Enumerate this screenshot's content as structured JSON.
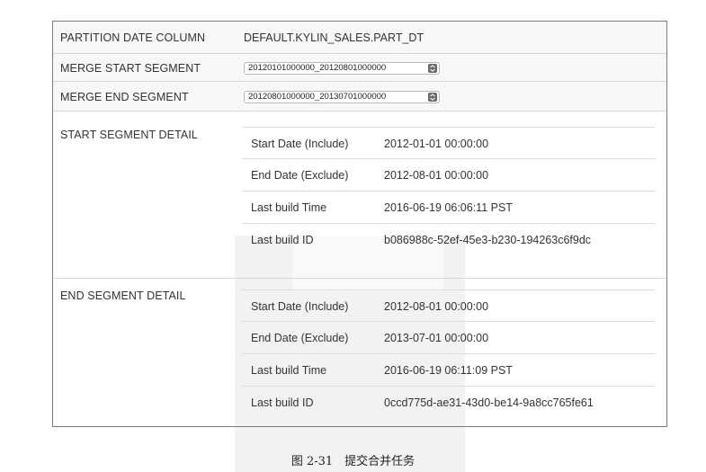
{
  "rows": {
    "partition": {
      "label": "PARTITION DATE COLUMN",
      "value": "DEFAULT.KYLIN_SALES.PART_DT"
    },
    "merge_start": {
      "label": "MERGE START SEGMENT",
      "selected": "20120101000000_20120801000000"
    },
    "merge_end": {
      "label": "MERGE END SEGMENT",
      "selected": "20120801000000_20130701000000"
    },
    "start_detail": {
      "label": "START SEGMENT DETAIL",
      "items": [
        {
          "key": "Start Date (Include)",
          "val": "2012-01-01 00:00:00"
        },
        {
          "key": "End Date (Exclude)",
          "val": "2012-08-01 00:00:00"
        },
        {
          "key": "Last build Time",
          "val": "2016-06-19 06:06:11 PST"
        },
        {
          "key": "Last build ID",
          "val": "b086988c-52ef-45e3-b230-194263c6f9dc"
        }
      ]
    },
    "end_detail": {
      "label": "END SEGMENT DETAIL",
      "items": [
        {
          "key": "Start Date (Include)",
          "val": "2012-08-01 00:00:00"
        },
        {
          "key": "End Date (Exclude)",
          "val": "2013-07-01 00:00:00"
        },
        {
          "key": "Last build Time",
          "val": "2016-06-19 06:11:09 PST"
        },
        {
          "key": "Last build ID",
          "val": "0ccd775d-ae31-43d0-be14-9a8cc765fe61"
        }
      ]
    }
  },
  "caption": "图 2-31　提交合并任务",
  "icons": {
    "select_stepper": "up-down-chevron-icon"
  }
}
